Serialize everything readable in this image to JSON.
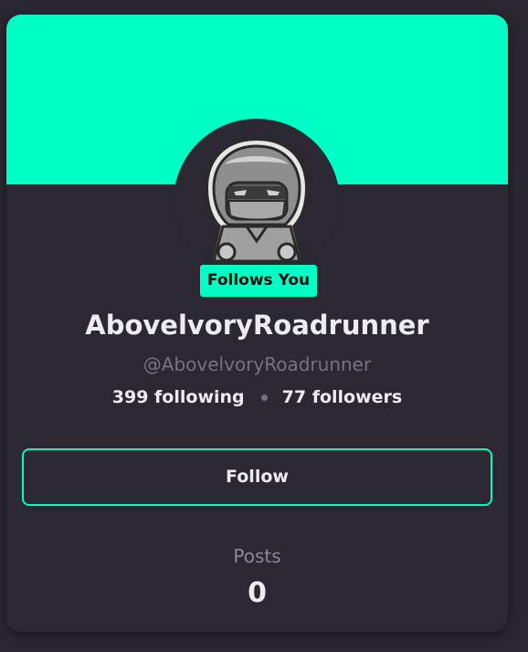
{
  "colors": {
    "accent": "#00ffc4",
    "card_background": "#2b2733",
    "text_primary": "#ecebf1",
    "text_muted": "#76727f"
  },
  "profile": {
    "avatar_icon": "hooded-ninja-avatar",
    "follows_you_badge": "Follows You",
    "display_name": "AbovelvoryRoadrunner",
    "username": "@AbovelvoryRoadrunner",
    "following": "399 following",
    "followers": "77 followers"
  },
  "actions": {
    "follow_label": "Follow"
  },
  "posts": {
    "label": "Posts",
    "count": "0"
  }
}
